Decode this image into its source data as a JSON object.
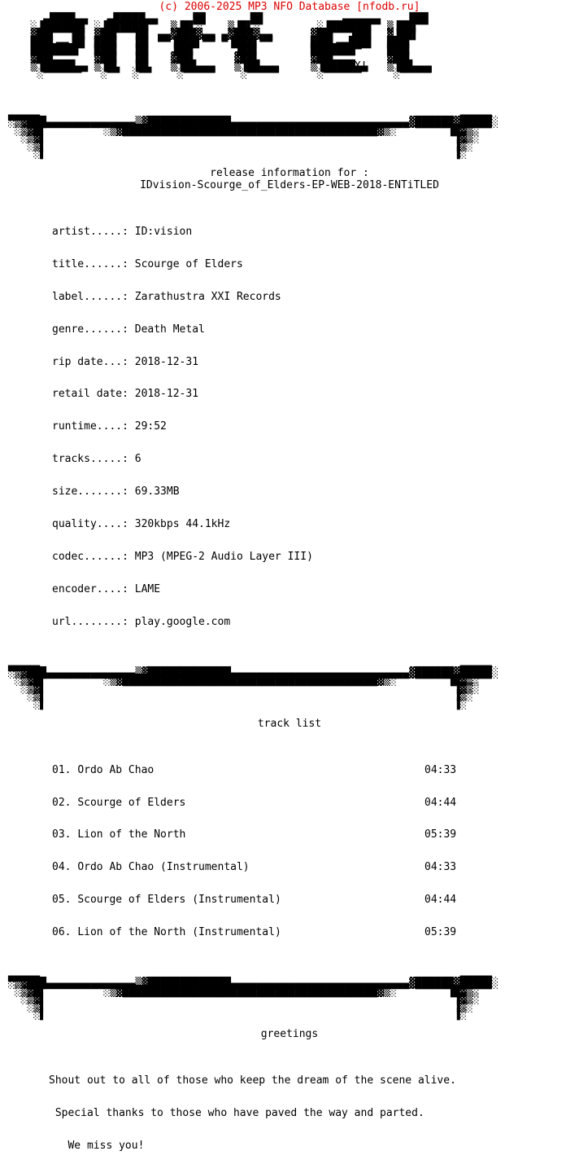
{
  "header": {
    "copyright": "(c) 2006-2025 MP3 NFO Database [nfodb.ru]",
    "copyright_color": "#dd0000"
  },
  "logo": {
    "group_name": "entitled",
    "signature": "hX!",
    "art": "    ▄████▄▄   ▄█████▄▄     ▐█▌      ▐█▌            ▄▄▄▄▄▄    ▐██▌\n  ░▐██████▌ ░▐██████▌   ▒▐█▌░    ▒▐█▌░         ░▐██████▌  ▒▐██▌\n  ▓██▌  ▐█▌ ▓██▌  ▐█▌ ▄▄▓███▓▄▄ ▄▓███▓▄▄      ▓██▌  ▐██▌  ▓▐██▌\n  ███▌▄▄▐█▌ ███▌  ▐█▌ ▀▀▐███▌▀▀ ▀▐███▌▀▀      ███▌▄▄███▌  ███▌\n  ███████▌  ███▌  ▐█▌   ▐██▌      ▐██▌        ███████▀    ███▌\n  ▓██▌      ▓██▌  ▐█▌   ▓██▌      ▓██▌        ▓██▌        ▓██▌\n  ▒▐█████▄▄ ▒▐█▌  ▐█▌   ▒▐██▄▄▄   ▒▐██▄▄▄     ▒▐█████▄▄   ▒▐██▄▄▄\n   ░▀▀▀▀▀▀   ░▀▀  ░▀▀    ░▀▀▀▀▀    ░▀▀▀▀▀      ░▀▀▀▀▀▀     ░▀▀▀▀▀"
  },
  "divider": {
    "art": "▄▄▄▄▄                                                                  ▄▄▄▄▄\n░▒▓███▄▄▄▄▄▄▄▄▄▄▄▄▄▄▒▓█████████████▄▄▄▄▄▄▄▄▄▄▄▄▄▄▄▄▄▄▄▄▄▄▄▄▄▄▄▄▓██████▓█████░\n ░▒▓█▌         ░▒▓████████████████████████████████████████▓▒░        ▐█▓▒░\n  ░▒▓▌                                                                ▐▓▒░\n   ░▒▌                                                                ▐▒░\n    ░▌                                                                ▐░"
  },
  "release": {
    "heading": "release information for :",
    "dirname": "IDvision-Scourge_of_Elders-EP-WEB-2018-ENTiTLED",
    "fields": [
      {
        "label": "artist.....:",
        "value": "ID:vision"
      },
      {
        "label": "title......:",
        "value": "Scourge of Elders"
      },
      {
        "label": "label......:",
        "value": "Zarathustra XXI Records"
      },
      {
        "label": "genre......:",
        "value": "Death Metal"
      },
      {
        "label": "rip date...:",
        "value": "2018-12-31"
      },
      {
        "label": "retail date:",
        "value": "2018-12-31"
      },
      {
        "label": "runtime....:",
        "value": "29:52"
      },
      {
        "label": "tracks.....:",
        "value": "6"
      },
      {
        "label": "size.......:",
        "value": "69.33MB"
      },
      {
        "label": "quality....:",
        "value": "320kbps 44.1kHz"
      },
      {
        "label": "codec......:",
        "value": "MP3 (MPEG-2 Audio Layer III)"
      },
      {
        "label": "encoder....:",
        "value": "LAME"
      },
      {
        "label": "url........:",
        "value": "play.google.com"
      }
    ]
  },
  "tracklist": {
    "heading": "track list",
    "tracks": [
      {
        "num": "01.",
        "title": "Ordo Ab Chao",
        "time": "04:33"
      },
      {
        "num": "02.",
        "title": "Scourge of Elders",
        "time": "04:44"
      },
      {
        "num": "03.",
        "title": "Lion of the North",
        "time": "05:39"
      },
      {
        "num": "04.",
        "title": "Ordo Ab Chao (Instrumental)",
        "time": "04:33"
      },
      {
        "num": "05.",
        "title": "Scourge of Elders (Instrumental)",
        "time": "04:44"
      },
      {
        "num": "06.",
        "title": "Lion of the North (Instrumental)",
        "time": "05:39"
      }
    ]
  },
  "greetings": {
    "heading": "greetings",
    "lines": [
      "Shout out to all of those who keep the dream of the scene alive.",
      " Special thanks to those who have paved the way and parted.",
      "   We miss you!"
    ]
  }
}
